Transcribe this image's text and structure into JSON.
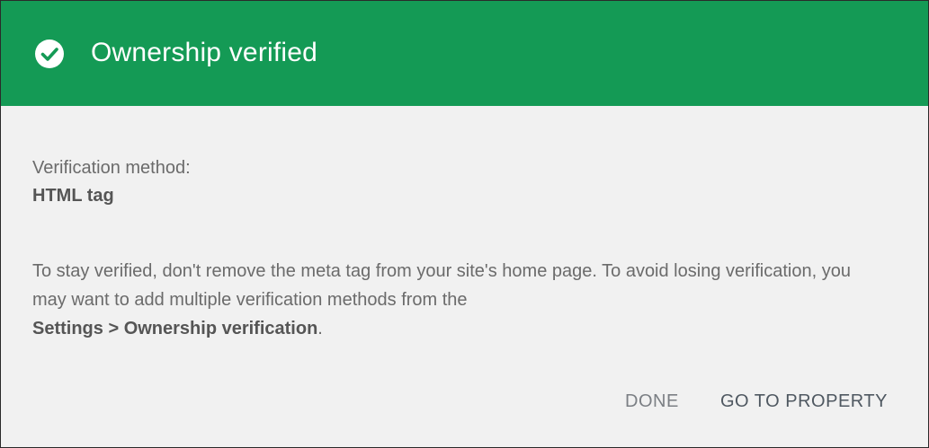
{
  "dialog": {
    "title": "Ownership verified",
    "status_icon": "check-circle-icon",
    "method_label": "Verification method:",
    "method_value": "HTML tag",
    "note_text": "To stay verified, don't remove the meta tag from your site's home page. To avoid losing verification, you may want to add multiple verification methods from the",
    "note_link": "Settings > Ownership verification",
    "note_end": ".",
    "buttons": {
      "done": "DONE",
      "go_to_property": "GO TO PROPERTY"
    },
    "colors": {
      "header_bg": "#149a55",
      "body_bg": "#f1f1f1"
    }
  }
}
